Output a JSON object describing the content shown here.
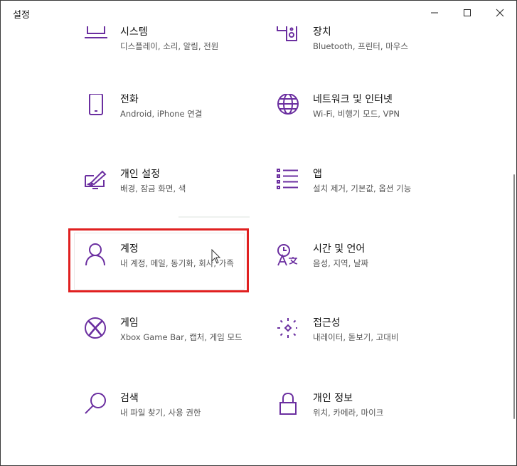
{
  "window": {
    "title": "설정"
  },
  "accent_color": "#6b2fa0",
  "tiles": [
    {
      "icon": "laptop-icon",
      "title": "시스템",
      "desc": "디스플레이, 소리, 알림, 전원"
    },
    {
      "icon": "devices-icon",
      "title": "장치",
      "desc": "Bluetooth, 프린터, 마우스"
    },
    {
      "icon": "phone-icon",
      "title": "전화",
      "desc": "Android, iPhone 연결"
    },
    {
      "icon": "globe-icon",
      "title": "네트워크 및 인터넷",
      "desc": "Wi-Fi, 비행기 모드, VPN"
    },
    {
      "icon": "personalization-icon",
      "title": "개인 설정",
      "desc": "배경, 잠금 화면, 색"
    },
    {
      "icon": "apps-list-icon",
      "title": "앱",
      "desc": "설치 제거, 기본값, 옵션 기능"
    },
    {
      "icon": "person-icon",
      "title": "계정",
      "desc": "내 계정, 메일, 동기화, 회사, 가족"
    },
    {
      "icon": "time-language-icon",
      "title": "시간 및 언어",
      "desc": "음성, 지역, 날짜"
    },
    {
      "icon": "xbox-icon",
      "title": "게임",
      "desc": "Xbox Game Bar, 캡처, 게임 모드"
    },
    {
      "icon": "accessibility-icon",
      "title": "접근성",
      "desc": "내레이터, 돋보기, 고대비"
    },
    {
      "icon": "search-icon",
      "title": "검색",
      "desc": "내 파일 찾기, 사용 권한"
    },
    {
      "icon": "lock-icon",
      "title": "개인 정보",
      "desc": "위치, 카메라, 마이크"
    }
  ]
}
